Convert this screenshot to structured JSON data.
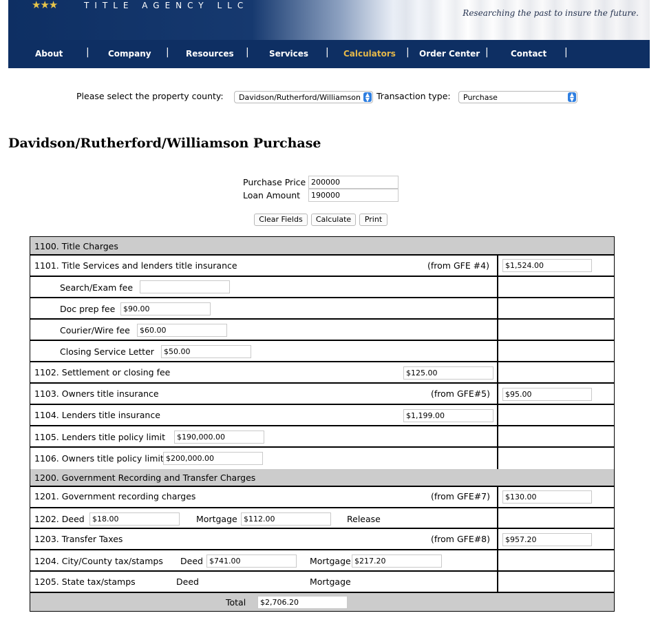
{
  "header": {
    "stars": "★★★",
    "brand": "TITLE AGENCY LLC",
    "tagline": "Researching the past to insure the future."
  },
  "nav": {
    "items": [
      {
        "label": "About"
      },
      {
        "label": "Company"
      },
      {
        "label": "Resources"
      },
      {
        "label": "Services"
      },
      {
        "label": "Calculators"
      },
      {
        "label": "Order Center"
      },
      {
        "label": "Contact"
      }
    ],
    "active": "Calculators",
    "active_color": "#e5b84a",
    "bar_color": "#0e2f63"
  },
  "selectors": {
    "county_label": "Please select the property county:",
    "county_value": "Davidson/Rutherford/Williamson",
    "transaction_label": "Transaction type:",
    "transaction_value": "Purchase"
  },
  "page_title": "Davidson/Rutherford/Williamson Purchase",
  "inputs": {
    "purchase_price_label": "Purchase Price",
    "purchase_price_value": "200000",
    "loan_amount_label": "Loan Amount",
    "loan_amount_value": "190000"
  },
  "buttons": {
    "clear": "Clear Fields",
    "calculate": "Calculate",
    "print": "Print"
  },
  "table": {
    "section_1100": "1100. Title Charges",
    "r1101": {
      "label": "1101. Title Services and lenders title insurance",
      "gfe": "(from GFE #4)",
      "value": "$1,524.00"
    },
    "search_exam": {
      "label": "Search/Exam fee",
      "value": ""
    },
    "doc_prep": {
      "label": "Doc prep fee",
      "value": "$90.00"
    },
    "courier": {
      "label": "Courier/Wire fee",
      "value": "$60.00"
    },
    "closing_letter": {
      "label": "Closing Service Letter",
      "value": "$50.00"
    },
    "r1102": {
      "label": "1102. Settlement or closing fee",
      "value": "$125.00"
    },
    "r1103": {
      "label": "1103. Owners title insurance",
      "gfe": "(from GFE#5)",
      "value": "$95.00"
    },
    "r1104": {
      "label": "1104. Lenders title insurance",
      "value": "$1,199.00"
    },
    "r1105": {
      "label": "1105. Lenders title policy limit",
      "value": "$190,000.00"
    },
    "r1106": {
      "label": "1106. Owners title policy limit",
      "value": "$200,000.00"
    },
    "section_1200": "1200. Government Recording and Transfer Charges",
    "r1201": {
      "label": "1201. Government recording charges",
      "gfe": "(from GFE#7)",
      "value": "$130.00"
    },
    "r1202": {
      "label": "1202. Deed",
      "deed_value": "$18.00",
      "mortgage_label": "Mortgage",
      "mortgage_value": "$112.00",
      "release_label": "Release"
    },
    "r1203": {
      "label": "1203. Transfer Taxes",
      "gfe": "(from GFE#8)",
      "value": "$957.20"
    },
    "r1204": {
      "label": "1204. City/County tax/stamps",
      "deed_label": "Deed",
      "deed_value": "$741.00",
      "mortgage_label": "Mortgage",
      "mortgage_value": "$217.20"
    },
    "r1205": {
      "label": "1205. State tax/stamps",
      "deed_label": "Deed",
      "mortgage_label": "Mortgage"
    },
    "total_label": "Total",
    "total_value": "$2,706.20"
  }
}
